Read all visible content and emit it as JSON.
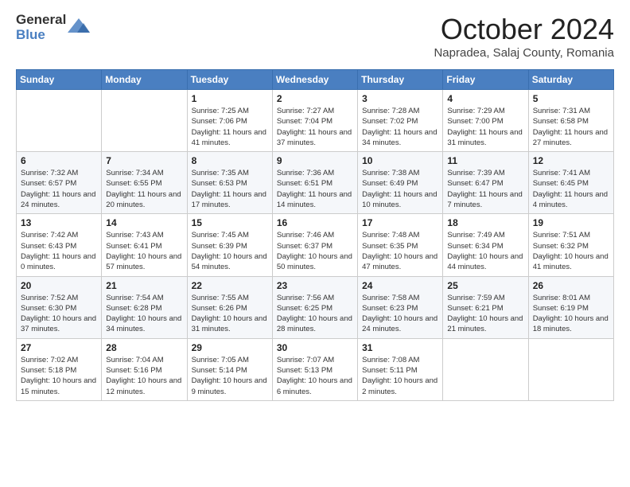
{
  "header": {
    "logo_general": "General",
    "logo_blue": "Blue",
    "month_title": "October 2024",
    "location": "Napradea, Salaj County, Romania"
  },
  "days_of_week": [
    "Sunday",
    "Monday",
    "Tuesday",
    "Wednesday",
    "Thursday",
    "Friday",
    "Saturday"
  ],
  "weeks": [
    [
      {
        "day": "",
        "info": ""
      },
      {
        "day": "",
        "info": ""
      },
      {
        "day": "1",
        "info": "Sunrise: 7:25 AM\nSunset: 7:06 PM\nDaylight: 11 hours and 41 minutes."
      },
      {
        "day": "2",
        "info": "Sunrise: 7:27 AM\nSunset: 7:04 PM\nDaylight: 11 hours and 37 minutes."
      },
      {
        "day": "3",
        "info": "Sunrise: 7:28 AM\nSunset: 7:02 PM\nDaylight: 11 hours and 34 minutes."
      },
      {
        "day": "4",
        "info": "Sunrise: 7:29 AM\nSunset: 7:00 PM\nDaylight: 11 hours and 31 minutes."
      },
      {
        "day": "5",
        "info": "Sunrise: 7:31 AM\nSunset: 6:58 PM\nDaylight: 11 hours and 27 minutes."
      }
    ],
    [
      {
        "day": "6",
        "info": "Sunrise: 7:32 AM\nSunset: 6:57 PM\nDaylight: 11 hours and 24 minutes."
      },
      {
        "day": "7",
        "info": "Sunrise: 7:34 AM\nSunset: 6:55 PM\nDaylight: 11 hours and 20 minutes."
      },
      {
        "day": "8",
        "info": "Sunrise: 7:35 AM\nSunset: 6:53 PM\nDaylight: 11 hours and 17 minutes."
      },
      {
        "day": "9",
        "info": "Sunrise: 7:36 AM\nSunset: 6:51 PM\nDaylight: 11 hours and 14 minutes."
      },
      {
        "day": "10",
        "info": "Sunrise: 7:38 AM\nSunset: 6:49 PM\nDaylight: 11 hours and 10 minutes."
      },
      {
        "day": "11",
        "info": "Sunrise: 7:39 AM\nSunset: 6:47 PM\nDaylight: 11 hours and 7 minutes."
      },
      {
        "day": "12",
        "info": "Sunrise: 7:41 AM\nSunset: 6:45 PM\nDaylight: 11 hours and 4 minutes."
      }
    ],
    [
      {
        "day": "13",
        "info": "Sunrise: 7:42 AM\nSunset: 6:43 PM\nDaylight: 11 hours and 0 minutes."
      },
      {
        "day": "14",
        "info": "Sunrise: 7:43 AM\nSunset: 6:41 PM\nDaylight: 10 hours and 57 minutes."
      },
      {
        "day": "15",
        "info": "Sunrise: 7:45 AM\nSunset: 6:39 PM\nDaylight: 10 hours and 54 minutes."
      },
      {
        "day": "16",
        "info": "Sunrise: 7:46 AM\nSunset: 6:37 PM\nDaylight: 10 hours and 50 minutes."
      },
      {
        "day": "17",
        "info": "Sunrise: 7:48 AM\nSunset: 6:35 PM\nDaylight: 10 hours and 47 minutes."
      },
      {
        "day": "18",
        "info": "Sunrise: 7:49 AM\nSunset: 6:34 PM\nDaylight: 10 hours and 44 minutes."
      },
      {
        "day": "19",
        "info": "Sunrise: 7:51 AM\nSunset: 6:32 PM\nDaylight: 10 hours and 41 minutes."
      }
    ],
    [
      {
        "day": "20",
        "info": "Sunrise: 7:52 AM\nSunset: 6:30 PM\nDaylight: 10 hours and 37 minutes."
      },
      {
        "day": "21",
        "info": "Sunrise: 7:54 AM\nSunset: 6:28 PM\nDaylight: 10 hours and 34 minutes."
      },
      {
        "day": "22",
        "info": "Sunrise: 7:55 AM\nSunset: 6:26 PM\nDaylight: 10 hours and 31 minutes."
      },
      {
        "day": "23",
        "info": "Sunrise: 7:56 AM\nSunset: 6:25 PM\nDaylight: 10 hours and 28 minutes."
      },
      {
        "day": "24",
        "info": "Sunrise: 7:58 AM\nSunset: 6:23 PM\nDaylight: 10 hours and 24 minutes."
      },
      {
        "day": "25",
        "info": "Sunrise: 7:59 AM\nSunset: 6:21 PM\nDaylight: 10 hours and 21 minutes."
      },
      {
        "day": "26",
        "info": "Sunrise: 8:01 AM\nSunset: 6:19 PM\nDaylight: 10 hours and 18 minutes."
      }
    ],
    [
      {
        "day": "27",
        "info": "Sunrise: 7:02 AM\nSunset: 5:18 PM\nDaylight: 10 hours and 15 minutes."
      },
      {
        "day": "28",
        "info": "Sunrise: 7:04 AM\nSunset: 5:16 PM\nDaylight: 10 hours and 12 minutes."
      },
      {
        "day": "29",
        "info": "Sunrise: 7:05 AM\nSunset: 5:14 PM\nDaylight: 10 hours and 9 minutes."
      },
      {
        "day": "30",
        "info": "Sunrise: 7:07 AM\nSunset: 5:13 PM\nDaylight: 10 hours and 6 minutes."
      },
      {
        "day": "31",
        "info": "Sunrise: 7:08 AM\nSunset: 5:11 PM\nDaylight: 10 hours and 2 minutes."
      },
      {
        "day": "",
        "info": ""
      },
      {
        "day": "",
        "info": ""
      }
    ]
  ]
}
